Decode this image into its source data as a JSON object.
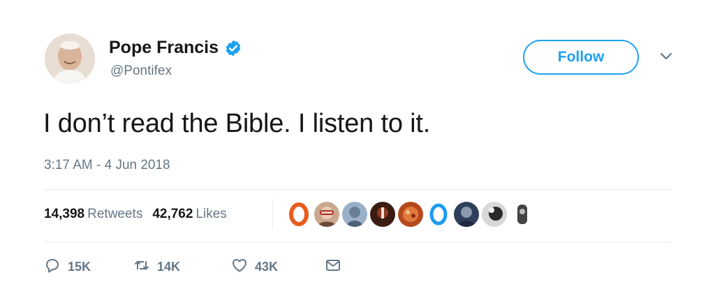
{
  "author": {
    "name": "Pope Francis",
    "handle": "@Pontifex",
    "verified": true
  },
  "follow_label": "Follow",
  "tweet_text": "I don’t read the Bible. I listen to it.",
  "timestamp": "3:17 AM - 4 Jun 2018",
  "stats": {
    "retweets_count": "14,398",
    "retweets_label": "Retweets",
    "likes_count": "42,762",
    "likes_label": "Likes"
  },
  "actions": {
    "reply_count": "15K",
    "retweet_count": "14K",
    "like_count": "43K"
  },
  "colors": {
    "accent": "#1da1f2",
    "text": "#14171a",
    "muted": "#657786",
    "divider": "#e6ecf0"
  },
  "icons": [
    "verified-badge-icon",
    "chevron-down-icon",
    "reply-icon",
    "retweet-icon",
    "heart-icon",
    "envelope-icon"
  ]
}
